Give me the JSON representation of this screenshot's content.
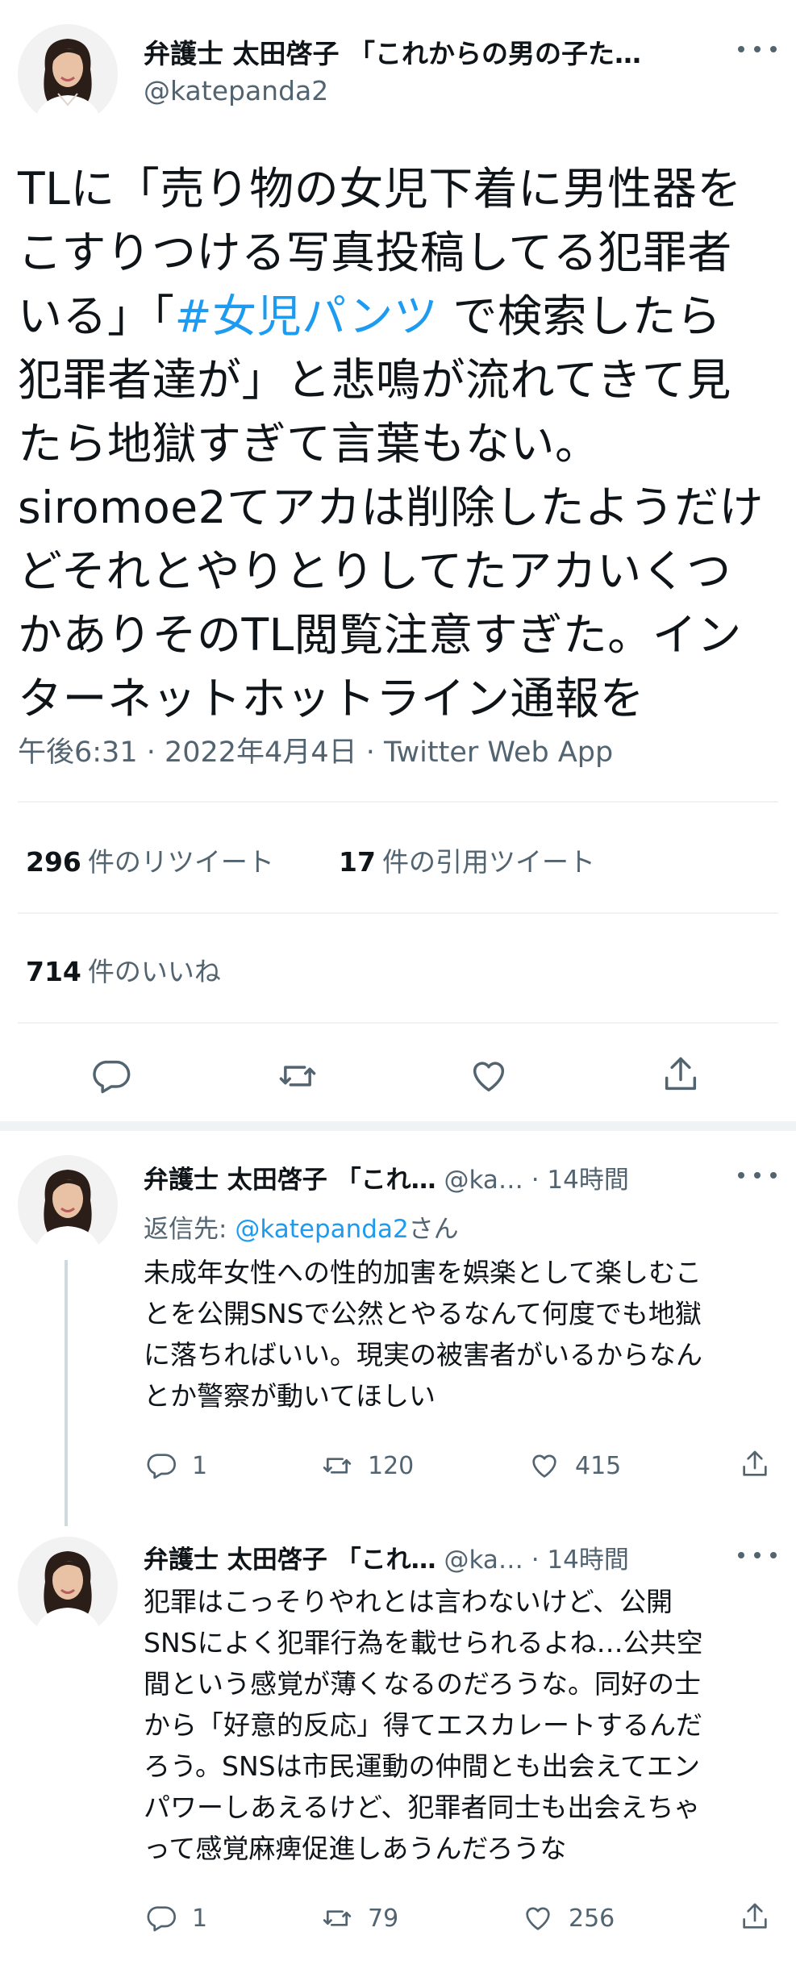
{
  "main_tweet": {
    "author_name": "弁護士 太田啓子 「これからの男の子た…",
    "handle": "@katepanda2",
    "body_lines": [
      {
        "text": "TLに「売り物の女児下着に男性器を"
      },
      {
        "text": "こすりつける写真投稿してる犯罪者"
      },
      {
        "pre": "いる」「",
        "hashtag": "#女児パンツ",
        "post": " で検索したら"
      },
      {
        "text": "犯罪者達が」と悲鳴が流れてきて見"
      },
      {
        "text": "たら地獄すぎて言葉もない。"
      },
      {
        "text": "siromoe2てアカは削除したようだけ"
      },
      {
        "text": "どそれとやりとりしてたアカいくつ"
      },
      {
        "text": "かありそのTL閲覧注意すぎた。イン"
      },
      {
        "text": "ターネットホットライン通報を"
      }
    ],
    "meta": "午後6:31 · 2022年4月4日 · Twitter Web App",
    "retweets": {
      "count": "296",
      "label": "件のリツイート"
    },
    "quotes": {
      "count": "17",
      "label": "件の引用ツイート"
    },
    "likes": {
      "count": "714",
      "label": "件のいいね"
    },
    "actions": [
      "reply-icon",
      "retweet-icon",
      "like-icon",
      "share-icon"
    ]
  },
  "replies": [
    {
      "author_name": "弁護士 太田啓子 「これ…",
      "handle": "@ka…",
      "time": "· 14時間",
      "reply_to_label": "返信先: ",
      "reply_to_handle": "@katepanda2",
      "reply_to_suffix": "さん",
      "body_lines": [
        "未成年女性への性的加害を娯楽として楽しむこ",
        "とを公開SNSで公然とやるなんて何度でも地獄",
        "に落ちればいい。現実の被害者がいるからなん",
        "とか警察が動いてほしい"
      ],
      "reply_count": "1",
      "retweet_count": "120",
      "like_count": "415"
    },
    {
      "author_name": "弁護士 太田啓子 「これ…",
      "handle": "@ka…",
      "time": "· 14時間",
      "body_lines": [
        "犯罪はこっそりやれとは言わないけど、公開",
        "SNSによく犯罪行為を載せられるよね…公共空",
        "間という感覚が薄くなるのだろうな。同好の士",
        "から「好意的反応」得てエスカレートするんだ",
        "ろう。SNSは市民運動の仲間とも出会えてエン",
        "パワーしあえるけど、犯罪者同士も出会えちゃ",
        "って感覚麻痺促進しあうんだろうな"
      ],
      "reply_count": "1",
      "retweet_count": "79",
      "like_count": "256"
    }
  ],
  "colors": {
    "text": "#0f1419",
    "secondary": "#536471",
    "link": "#1d9bf0",
    "divider": "#eff3f4"
  }
}
